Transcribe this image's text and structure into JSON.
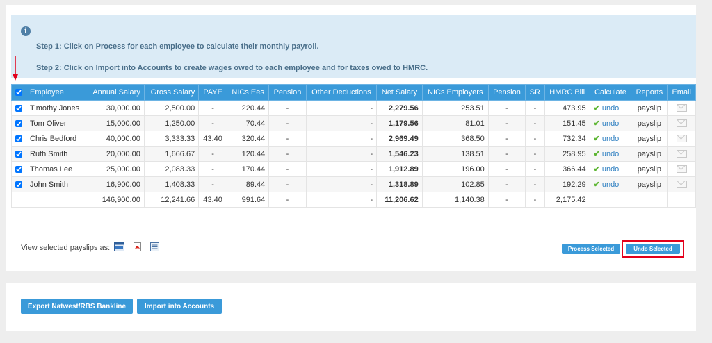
{
  "info": {
    "step1": "Step 1: Click on Process for each employee to calculate their monthly payroll.",
    "step2": "Step 2: Click on Import into Accounts to create wages owed to each employee and for taxes owed to HMRC."
  },
  "table": {
    "headers": {
      "employee": "Employee",
      "annual_salary": "Annual Salary",
      "gross_salary": "Gross Salary",
      "paye": "PAYE",
      "nics_ees": "NICs Ees",
      "pension": "Pension",
      "other_deductions": "Other Deductions",
      "net_salary": "Net Salary",
      "nics_employers": "NICs Employers",
      "pension_er": "Pension",
      "sr": "SR",
      "hmrc_bill": "HMRC Bill",
      "calculate": "Calculate",
      "reports": "Reports",
      "email": "Email"
    },
    "rows": [
      {
        "checked": true,
        "employee": "Timothy Jones",
        "annual_salary": "30,000.00",
        "gross_salary": "2,500.00",
        "paye": "-",
        "nics_ees": "220.44",
        "pension": "-",
        "other_deductions": "-",
        "net_salary": "2,279.56",
        "nics_employers": "253.51",
        "pension_er": "-",
        "sr": "-",
        "hmrc_bill": "473.95",
        "calculate": "undo",
        "reports": "payslip"
      },
      {
        "checked": true,
        "employee": "Tom Oliver",
        "annual_salary": "15,000.00",
        "gross_salary": "1,250.00",
        "paye": "-",
        "nics_ees": "70.44",
        "pension": "-",
        "other_deductions": "-",
        "net_salary": "1,179.56",
        "nics_employers": "81.01",
        "pension_er": "-",
        "sr": "-",
        "hmrc_bill": "151.45",
        "calculate": "undo",
        "reports": "payslip"
      },
      {
        "checked": true,
        "employee": "Chris Bedford",
        "annual_salary": "40,000.00",
        "gross_salary": "3,333.33",
        "paye": "43.40",
        "nics_ees": "320.44",
        "pension": "-",
        "other_deductions": "-",
        "net_salary": "2,969.49",
        "nics_employers": "368.50",
        "pension_er": "-",
        "sr": "-",
        "hmrc_bill": "732.34",
        "calculate": "undo",
        "reports": "payslip"
      },
      {
        "checked": true,
        "employee": "Ruth Smith",
        "annual_salary": "20,000.00",
        "gross_salary": "1,666.67",
        "paye": "-",
        "nics_ees": "120.44",
        "pension": "-",
        "other_deductions": "-",
        "net_salary": "1,546.23",
        "nics_employers": "138.51",
        "pension_er": "-",
        "sr": "-",
        "hmrc_bill": "258.95",
        "calculate": "undo",
        "reports": "payslip"
      },
      {
        "checked": true,
        "employee": "Thomas Lee",
        "annual_salary": "25,000.00",
        "gross_salary": "2,083.33",
        "paye": "-",
        "nics_ees": "170.44",
        "pension": "-",
        "other_deductions": "-",
        "net_salary": "1,912.89",
        "nics_employers": "196.00",
        "pension_er": "-",
        "sr": "-",
        "hmrc_bill": "366.44",
        "calculate": "undo",
        "reports": "payslip"
      },
      {
        "checked": true,
        "employee": "John Smith",
        "annual_salary": "16,900.00",
        "gross_salary": "1,408.33",
        "paye": "-",
        "nics_ees": "89.44",
        "pension": "-",
        "other_deductions": "-",
        "net_salary": "1,318.89",
        "nics_employers": "102.85",
        "pension_er": "-",
        "sr": "-",
        "hmrc_bill": "192.29",
        "calculate": "undo",
        "reports": "payslip"
      }
    ],
    "totals": {
      "annual_salary": "146,900.00",
      "gross_salary": "12,241.66",
      "paye": "43.40",
      "nics_ees": "991.64",
      "pension": "-",
      "other_deductions": "-",
      "net_salary": "11,206.62",
      "nics_employers": "1,140.38",
      "pension_er": "-",
      "sr": "-",
      "hmrc_bill": "2,175.42"
    }
  },
  "view_payslips_label": "View selected payslips as:",
  "formats": [
    "html-icon",
    "pdf-icon",
    "document-icon"
  ],
  "buttons": {
    "process_selected": "Process Selected",
    "undo_selected": "Undo Selected",
    "export": "Export Natwest/RBS Bankline",
    "import": "Import into Accounts"
  },
  "colors": {
    "accent": "#3a9ad9",
    "info_background": "#dbebf6",
    "highlight": "#e3001b",
    "tick": "#5cb531"
  }
}
